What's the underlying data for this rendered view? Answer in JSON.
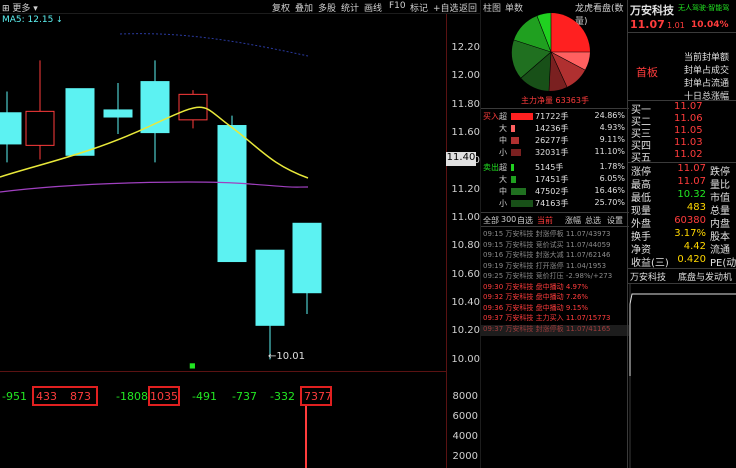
{
  "toolbar": {
    "left_label": "更多",
    "items": [
      "复权",
      "叠加",
      "多股",
      "统计",
      "画线",
      "F10",
      "标记",
      "+自选",
      "返回"
    ]
  },
  "chart": {
    "ma_label": "MA5: 12.15",
    "price_axis": [
      "12.20",
      "12.00",
      "11.80",
      "11.60",
      "11.40",
      "11.20",
      "11.00",
      "10.80",
      "10.60",
      "10.40",
      "10.20",
      "10.00"
    ],
    "current_price_tag": "11.40",
    "low_marker": "10.01",
    "candles": [
      {
        "open": 11.75,
        "close": 11.53,
        "high": 11.9,
        "low": 11.4
      },
      {
        "open": 11.52,
        "close": 11.76,
        "high": 12.12,
        "low": 11.42
      },
      {
        "open": 11.92,
        "close": 11.45,
        "high": 11.92,
        "low": 11.45
      },
      {
        "open": 11.77,
        "close": 11.72,
        "high": 11.96,
        "low": 11.6
      },
      {
        "open": 11.97,
        "close": 11.61,
        "high": 12.12,
        "low": 11.4
      },
      {
        "open": 11.7,
        "close": 11.88,
        "high": 11.91,
        "low": 11.64
      },
      {
        "open": 11.66,
        "close": 10.7,
        "high": 11.73,
        "low": 10.7
      },
      {
        "open": 10.78,
        "close": 10.25,
        "high": 10.78,
        "low": 10.01
      },
      {
        "open": 10.97,
        "close": 10.48,
        "high": 10.97,
        "low": 10.33
      }
    ],
    "net_flow_labels": [
      "-951",
      "433",
      "873",
      "-1808",
      "1035",
      "-491",
      "-737",
      "-332",
      "7377"
    ],
    "volume_axis": [
      "8000",
      "6000",
      "4000",
      "2000"
    ]
  },
  "right": {
    "tabs": [
      "柱图",
      "单数"
    ],
    "pie_title": "龙虎看盘(数量)",
    "pie_caption": "主力净量  63363手",
    "flow_buy_label": "买入",
    "flow_sell_label": "卖出",
    "buy_flows": [
      {
        "size": "超",
        "vol": "71722手",
        "pct": "24.86%",
        "color": "#ff2020",
        "frac": 1.0
      },
      {
        "size": "大",
        "vol": "14236手",
        "pct": "4.93%",
        "color": "#ff6060",
        "frac": 0.2
      },
      {
        "size": "中",
        "vol": "26277手",
        "pct": "9.11%",
        "color": "#b03030",
        "frac": 0.37
      },
      {
        "size": "小",
        "vol": "32031手",
        "pct": "11.10%",
        "color": "#7a2020",
        "frac": 0.45
      }
    ],
    "sell_flows": [
      {
        "size": "超",
        "vol": "5145手",
        "pct": "1.78%",
        "color": "#20d020",
        "frac": 0.07
      },
      {
        "size": "大",
        "vol": "17451手",
        "pct": "6.05%",
        "color": "#20a020",
        "frac": 0.24
      },
      {
        "size": "中",
        "vol": "47502手",
        "pct": "16.46%",
        "color": "#207020",
        "frac": 0.66
      },
      {
        "size": "小",
        "vol": "74163手",
        "pct": "25.70%",
        "color": "#185018",
        "frac": 1.0
      }
    ],
    "tick_tabs": [
      "全部",
      "300",
      "自选",
      "当前",
      "涨幅",
      "总选",
      "设置"
    ],
    "ticks": [
      {
        "text": "09:15 万安科技  封涨停板  11.07/43973",
        "color": "#8a8a8a"
      },
      {
        "text": "09:15 万安科技  竞价试买  11.07/44059",
        "color": "#8a8a8a"
      },
      {
        "text": "09:16 万安科技  封涨大减  11.07/62146",
        "color": "#8a8a8a"
      },
      {
        "text": "09:19 万安科技  打开涨停  11.04/1953",
        "color": "#8a8a8a"
      },
      {
        "text": "09:25 万安科技  竞价打压  -2.98%/+273",
        "color": "#8a8a8a"
      },
      {
        "text": "09:30 万安科技  盘中播动  4.97%",
        "color": "#ff3c3c"
      },
      {
        "text": "09:32 万安科技  盘中播动  7.26%",
        "color": "#ff3c3c"
      },
      {
        "text": "09:36 万安科技  盘中播动  9.15%",
        "color": "#ff3c3c"
      },
      {
        "text": "09:37 万安科技  主力买入  11.07/15773",
        "color": "#ff3c3c"
      },
      {
        "text": "09:37 万安科技  封涨停板  11.07/41165",
        "color": "#ff3c3c"
      }
    ],
    "stock_name": "万安科技",
    "stock_tag": "无人驾驶·智能驾",
    "price": "11.07",
    "change": "1.01",
    "change_pct": "10.04%",
    "board_label": "首板",
    "board_info": [
      "当前封单额",
      "封单占成交",
      "封单占流通",
      "十日总涨幅"
    ],
    "order_book": [
      {
        "label": "买一",
        "price": "11.07"
      },
      {
        "label": "买二",
        "price": "11.06"
      },
      {
        "label": "买三",
        "price": "11.05"
      },
      {
        "label": "买四",
        "price": "11.03"
      },
      {
        "label": "买五",
        "price": "11.02"
      }
    ],
    "stats": [
      {
        "k": "涨停",
        "v": "11.07",
        "k2": "跌停",
        "vc": "#ff3c3c"
      },
      {
        "k": "最高",
        "v": "11.07",
        "k2": "量比",
        "vc": "#ff3c3c"
      },
      {
        "k": "最低",
        "v": "10.32",
        "k2": "市值",
        "vc": "#22e622"
      },
      {
        "k": "现量",
        "v": "483",
        "k2": "总量",
        "vc": "#ffd700"
      },
      {
        "k": "外盘",
        "v": "60380",
        "k2": "内盘",
        "vc": "#ff3c3c"
      },
      {
        "k": "换手",
        "v": "3.17%",
        "k2": "股本",
        "vc": "#ffd700"
      },
      {
        "k": "净资",
        "v": "4.42",
        "k2": "流通",
        "vc": "#ffd700"
      },
      {
        "k": "收益(三)",
        "v": "0.420",
        "k2": "PE(动",
        "vc": "#ffd700"
      }
    ],
    "bottom_tabs": [
      "万安科技",
      "底盘与发动机"
    ]
  },
  "colors": {
    "up": "#ff3c3c",
    "down": "#5cf2f2",
    "ma": "#e8e83a",
    "ma2": "#a040c0",
    "grid": "#5a1212"
  }
}
